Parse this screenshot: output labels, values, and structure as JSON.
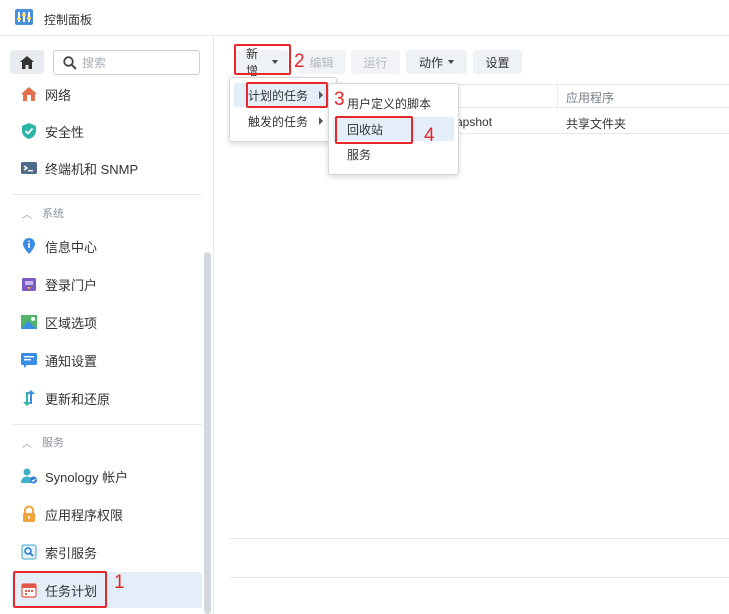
{
  "window": {
    "title": "控制面板"
  },
  "sidebar": {
    "search_placeholder": "搜索",
    "items_top": [
      {
        "label": "网络",
        "icon": "network-icon"
      },
      {
        "label": "安全性",
        "icon": "shield-icon"
      },
      {
        "label": "终端机和 SNMP",
        "icon": "terminal-icon"
      }
    ],
    "group_system": "系统",
    "items_system": [
      {
        "label": "信息中心",
        "icon": "info-icon"
      },
      {
        "label": "登录门户",
        "icon": "login-portal-icon"
      },
      {
        "label": "区域选项",
        "icon": "region-icon"
      },
      {
        "label": "通知设置",
        "icon": "notification-icon"
      },
      {
        "label": "更新和还原",
        "icon": "update-icon"
      }
    ],
    "group_services": "服务",
    "items_services": [
      {
        "label": "Synology 帐户",
        "icon": "account-icon"
      },
      {
        "label": "应用程序权限",
        "icon": "lock-icon"
      },
      {
        "label": "索引服务",
        "icon": "index-icon"
      },
      {
        "label": "任务计划",
        "icon": "calendar-icon"
      }
    ]
  },
  "toolbar": {
    "create": "新增",
    "edit": "编辑",
    "run": "运行",
    "action": "动作",
    "settings": "设置"
  },
  "table": {
    "columns": [
      "应用程序"
    ],
    "rows": [
      {
        "name_fragment": "apshot",
        "app": "共享文件夹"
      }
    ]
  },
  "menu_create": {
    "items": [
      "计划的任务",
      "触发的任务"
    ]
  },
  "menu_scheduled": {
    "items": [
      "用户定义的脚本",
      "回收站",
      "服务"
    ]
  },
  "annotations": [
    "1",
    "2",
    "3",
    "4"
  ],
  "colors": {
    "accent": "#e4eef9",
    "annotation": "#e8272a"
  }
}
